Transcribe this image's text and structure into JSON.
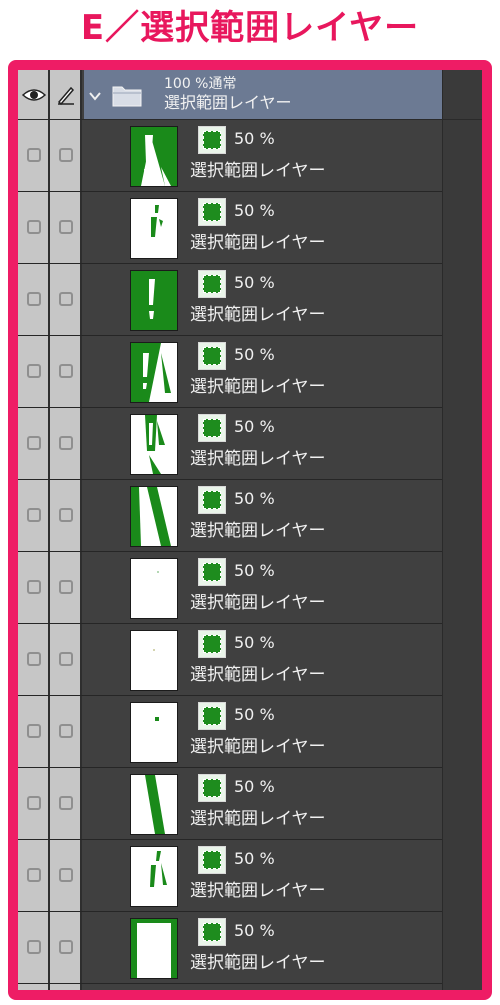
{
  "page": {
    "heading": "E／選択範囲レイヤー"
  },
  "colors": {
    "frame": "#ee1c65",
    "heading": "#e8175d",
    "panel_bg": "#404040",
    "column_bg": "#c6c6c6",
    "folder_bar": "#6c7a93",
    "mask_green": "#1e8c1e",
    "thumb_green": "#1a8a1a"
  },
  "header": {
    "visibility_icon": "eye-icon",
    "edit_icon": "pen-icon"
  },
  "folder": {
    "chevron_icon": "chevron-down-icon",
    "icon": "folder-icon",
    "opacity_mode": "100 %通常",
    "name": "選択範囲レイヤー"
  },
  "layers": [
    {
      "opacity": "50 %",
      "name": "選択範囲レイヤー",
      "thumb_icon": "thumbnail-strokes-dense"
    },
    {
      "opacity": "50 %",
      "name": "選択範囲レイヤー",
      "thumb_icon": "thumbnail-strokes-light"
    },
    {
      "opacity": "50 %",
      "name": "選択範囲レイヤー",
      "thumb_icon": "thumbnail-full-green"
    },
    {
      "opacity": "50 %",
      "name": "選択範囲レイヤー",
      "thumb_icon": "thumbnail-strokes-dense"
    },
    {
      "opacity": "50 %",
      "name": "選択範囲レイヤー",
      "thumb_icon": "thumbnail-strokes-medium"
    },
    {
      "opacity": "50 %",
      "name": "選択範囲レイヤー",
      "thumb_icon": "thumbnail-diagonal-band"
    },
    {
      "opacity": "50 %",
      "name": "選択範囲レイヤー",
      "thumb_icon": "thumbnail-blank"
    },
    {
      "opacity": "50 %",
      "name": "選択範囲レイヤー",
      "thumb_icon": "thumbnail-blank"
    },
    {
      "opacity": "50 %",
      "name": "選択範囲レイヤー",
      "thumb_icon": "thumbnail-dot"
    },
    {
      "opacity": "50 %",
      "name": "選択範囲レイヤー",
      "thumb_icon": "thumbnail-single-stroke"
    },
    {
      "opacity": "50 %",
      "name": "選択範囲レイヤー",
      "thumb_icon": "thumbnail-strokes-light"
    },
    {
      "opacity": "50 %",
      "name": "選択範囲レイヤー",
      "thumb_icon": "thumbnail-green-border"
    }
  ]
}
